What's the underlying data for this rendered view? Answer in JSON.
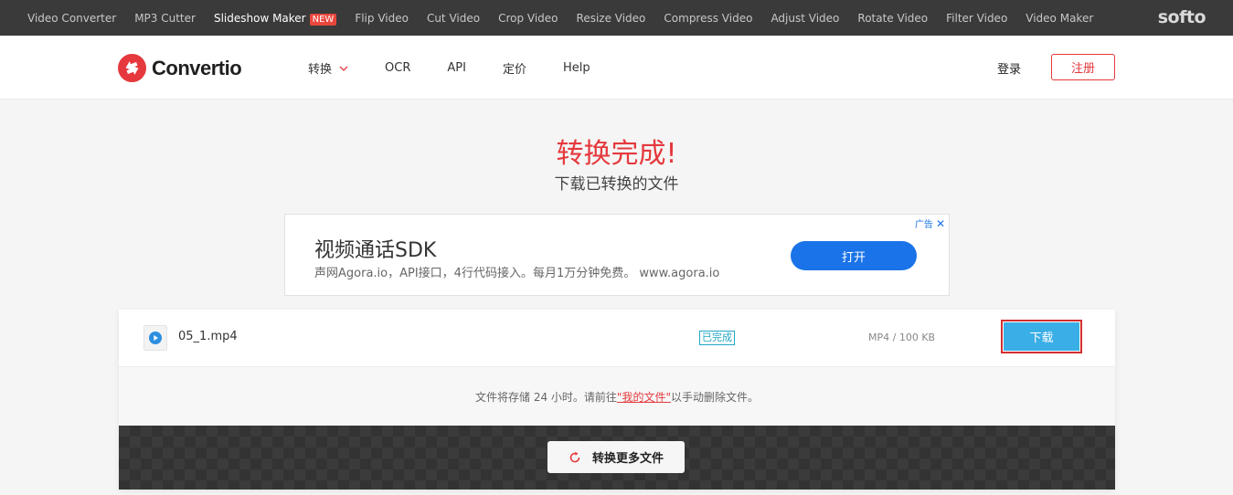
{
  "topbar": {
    "tools": [
      {
        "label": "Video Converter",
        "active": false
      },
      {
        "label": "MP3 Cutter",
        "active": false
      },
      {
        "label": "Slideshow Maker",
        "active": true
      },
      {
        "label": "Flip Video",
        "active": false
      },
      {
        "label": "Cut Video",
        "active": false
      },
      {
        "label": "Crop Video",
        "active": false
      },
      {
        "label": "Resize Video",
        "active": false
      },
      {
        "label": "Compress Video",
        "active": false
      },
      {
        "label": "Adjust Video",
        "active": false
      },
      {
        "label": "Rotate Video",
        "active": false
      },
      {
        "label": "Filter Video",
        "active": false
      },
      {
        "label": "Video Maker",
        "active": false
      }
    ],
    "new_badge": "NEW",
    "brand": "softo"
  },
  "header": {
    "logo_text": "Convertio",
    "nav": {
      "convert": "转换",
      "ocr": "OCR",
      "api": "API",
      "pricing": "定价",
      "help": "Help"
    },
    "login": "登录",
    "signup": "注册"
  },
  "hero": {
    "title": "转换完成!",
    "subtitle": "下载已转换的文件"
  },
  "ad": {
    "title": "视频通话SDK",
    "description": "声网Agora.io，API接口，4行代码接入。每月1万分钟免费。 www.agora.io",
    "button": "打开",
    "label": "广告"
  },
  "file": {
    "name": "05_1.mp4",
    "status": "已完成",
    "meta": "MP4 / 100 KB",
    "download": "下载"
  },
  "notice": {
    "before": "文件将存储 24 小时。请前往",
    "link": "\"我的文件\"",
    "after": "以手动删除文件。"
  },
  "more": {
    "label": "转换更多文件"
  },
  "colors": {
    "brand_red": "#e5393d",
    "download_blue": "#3aaee6",
    "ad_blue": "#1a73e8",
    "status_teal": "#21a6c4"
  }
}
